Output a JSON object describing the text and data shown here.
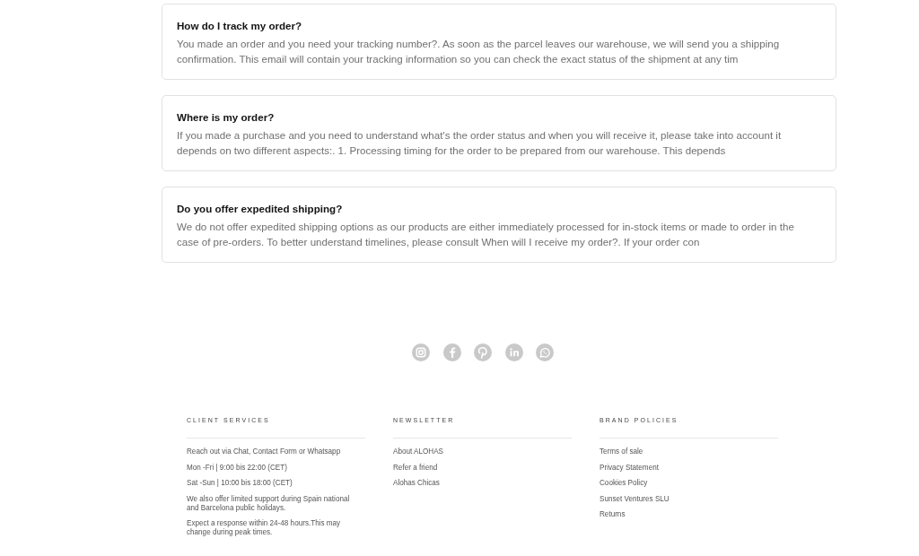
{
  "faq": [
    {
      "question": "How do I track my order?",
      "answer": "You made an order and you need your tracking number?. As soon as the parcel leaves our warehouse, we will send you a shipping confirmation. This email will contain your tracking information so you can check the exact status of the shipment at any tim"
    },
    {
      "question": "Where is my order?",
      "answer": "If you made a purchase and you need to understand what's the order status and when you will receive it, please take into account it depends on two different aspects:. 1. Processing timing for the order to be prepared from our warehouse. This depends"
    },
    {
      "question": "Do you offer expedited shipping?",
      "answer": "We do not offer expedited shipping options as our products are either immediately processed for in-stock items or made to order in the case of pre-orders. To better understand timelines, please consult When will I receive my order?. If your order con"
    }
  ],
  "social_icons": [
    {
      "kind": "instagram"
    },
    {
      "kind": "facebook"
    },
    {
      "kind": "pinterest"
    },
    {
      "kind": "linkedin"
    },
    {
      "kind": "whatsapp"
    }
  ],
  "footer_columns": [
    {
      "heading": "CLIENT SERVICES",
      "kind": "info",
      "items": [
        "Reach out via Chat, Contact Form or Whatsapp",
        "Mon -Fri | 9:00 bis 22:00 (CET)",
        "Sat -Sun | 10:00 bis 18:00 (CET)",
        "We also offer limited support during Spain national and Barcelona public holidays.",
        "Expect a response within 24-48 hours.This may change during peak times."
      ]
    },
    {
      "heading": "NEWSLETTER",
      "kind": "links",
      "items": [
        "About ALOHAS",
        "Refer a friend",
        "Alohas Chicas"
      ]
    },
    {
      "heading": "BRAND POLICIES",
      "kind": "links",
      "items": [
        "Terms of sale",
        "Privacy Statement",
        "Cookies Policy",
        "Sunset Ventures SLU",
        "Returns"
      ]
    }
  ]
}
